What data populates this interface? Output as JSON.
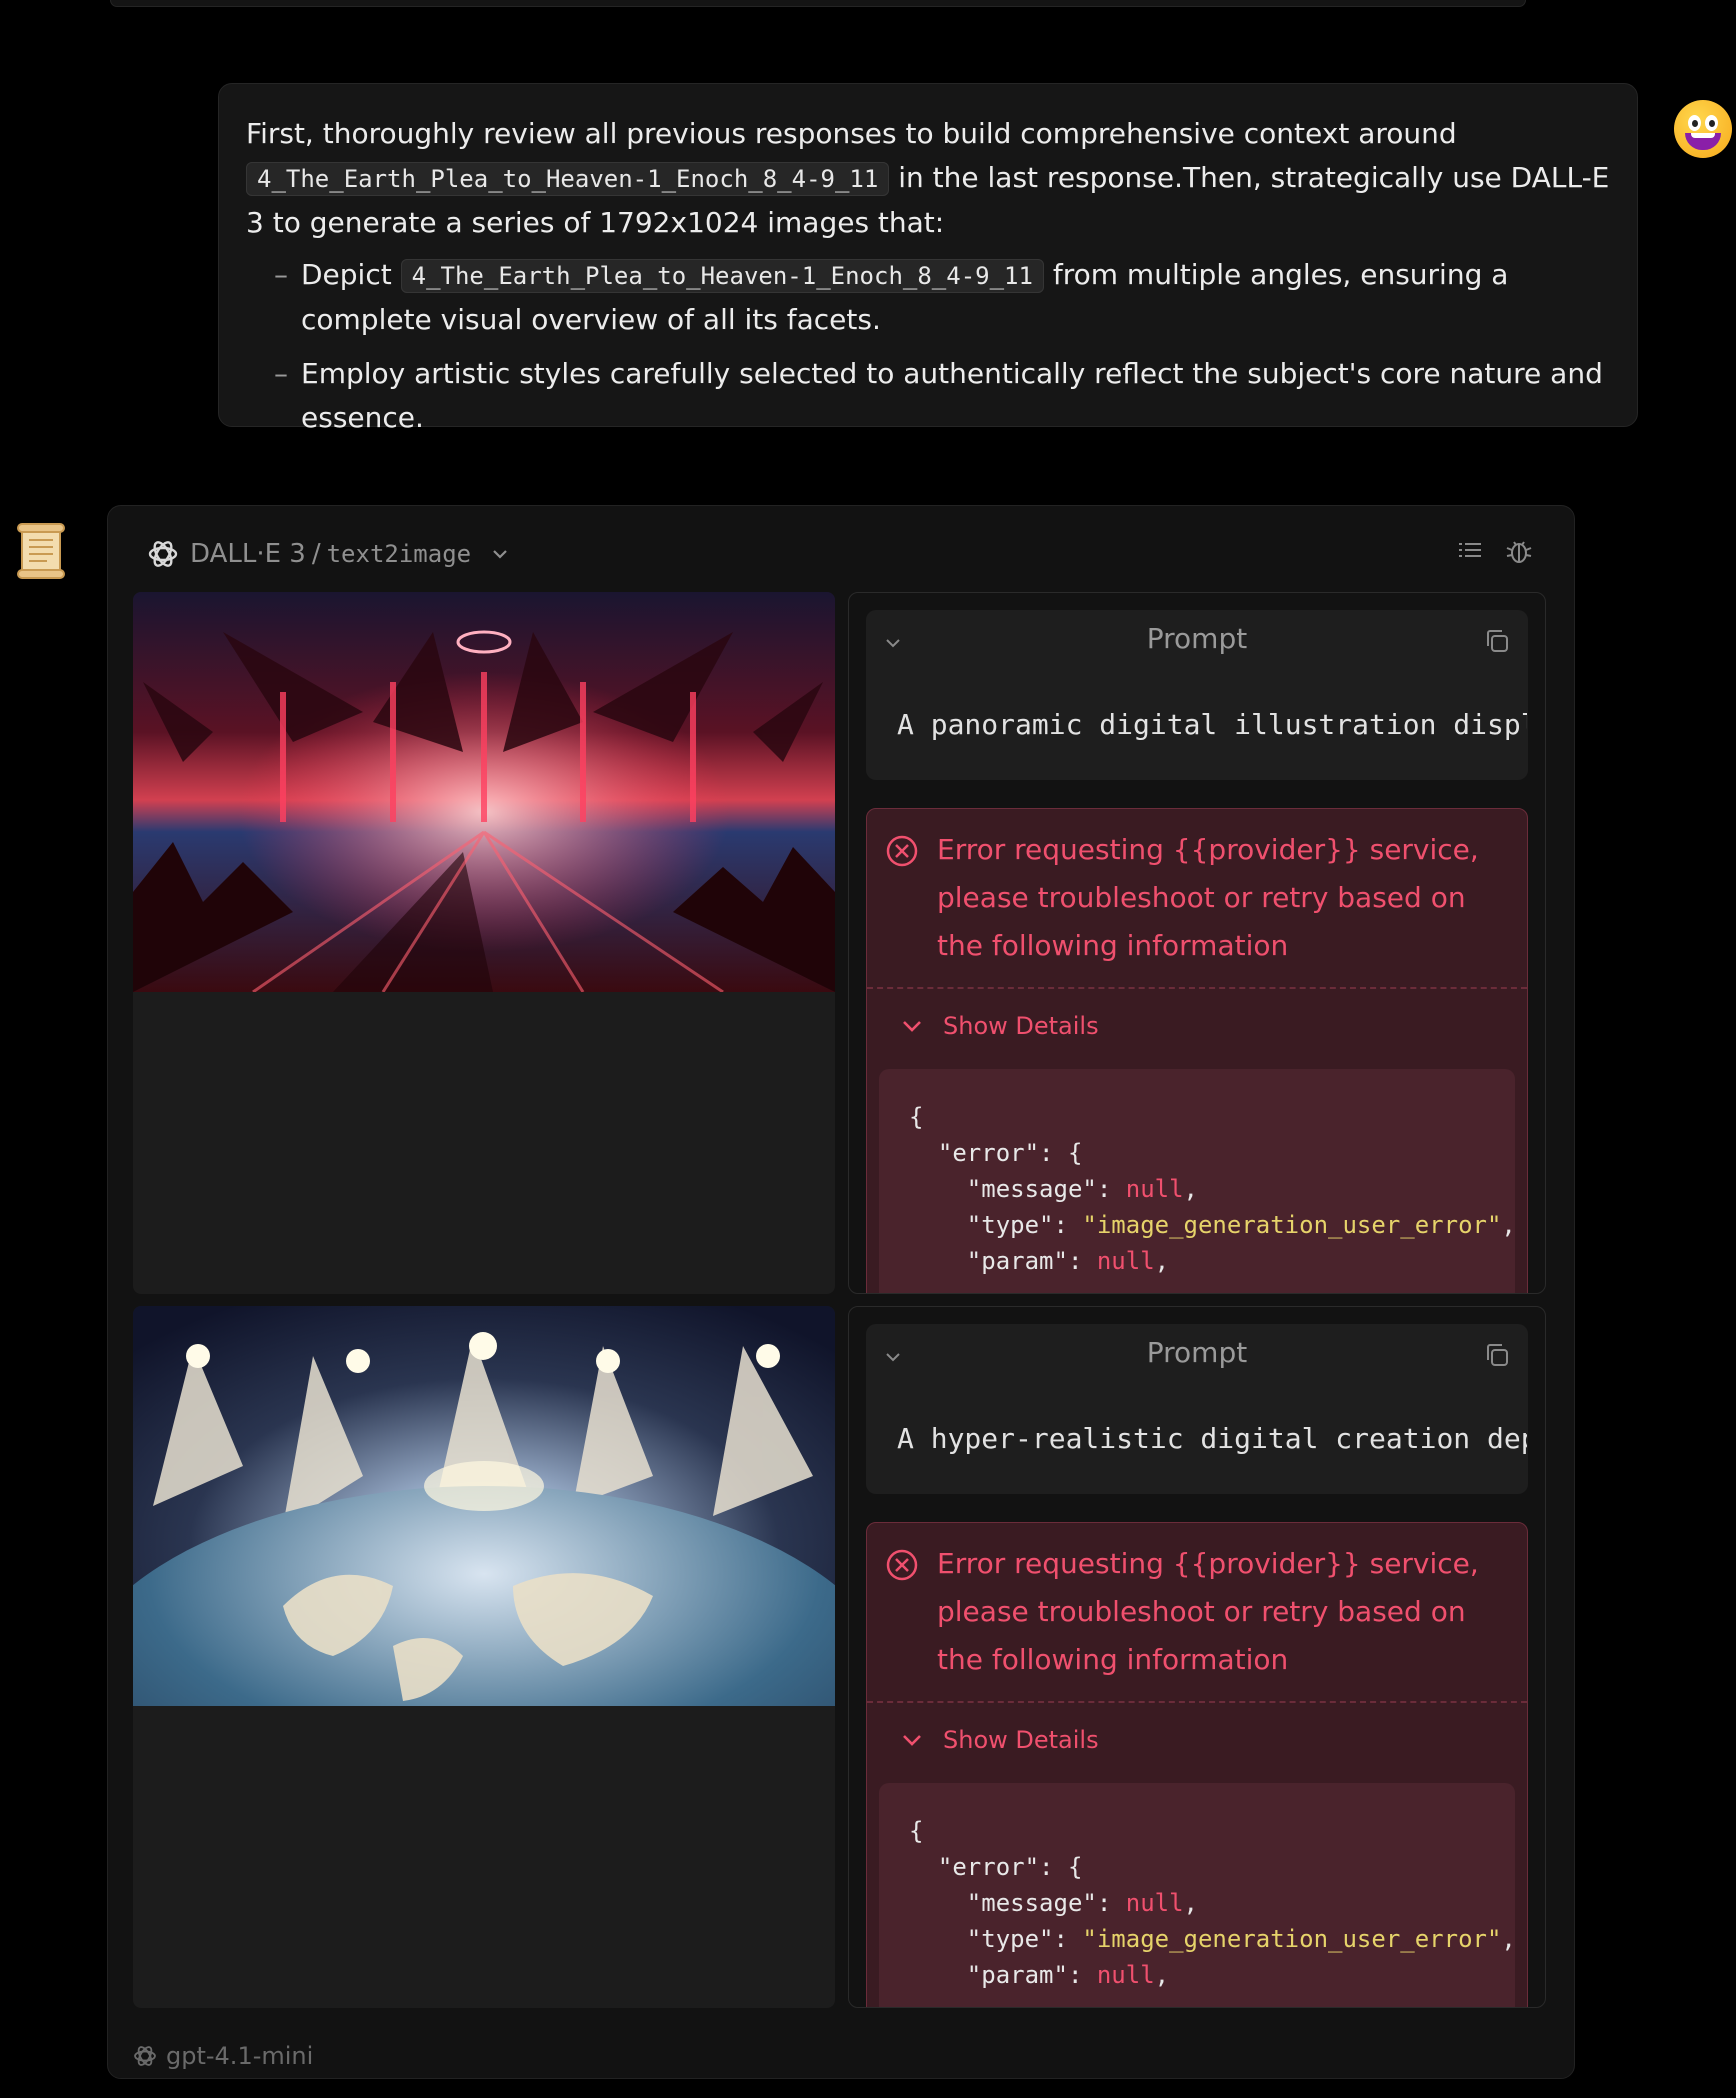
{
  "user_message": {
    "intro_before": "First, thoroughly review all previous responses to build comprehensive context around",
    "code_ref": "4_The_Earth_Plea_to_Heaven-1_Enoch_8_4-9_11",
    "intro_after": "in the last response.Then, strategically use DALL-E 3 to generate a series of 1792x1024 images that:",
    "bullet1_before": "Depict",
    "bullet1_after": "from multiple angles, ensuring a complete visual overview of all its facets.",
    "bullet2": "Employ artistic styles carefully selected to authentically reflect the subject's core nature and essence."
  },
  "tool": {
    "name": "DALL·E 3",
    "separator": "/",
    "api": "text2image",
    "icons": [
      "openai-logo-icon",
      "list-icon",
      "bug-icon",
      "chevron-down-icon"
    ]
  },
  "results": [
    {
      "image_icon": "generated-image-crimson-angels",
      "prompt_title": "Prompt",
      "prompt_text": "A panoramic digital illustration displ",
      "error_message": "Error requesting {{provider}} service, please troubleshoot or retry based on the following information",
      "show_details": "Show Details",
      "json_lines": [
        "{",
        "  \"error\": {",
        "    \"message\": ",
        "null",
        ",",
        "    \"type\": ",
        "\"image_generation_user_error\"",
        ",",
        "    \"param\": ",
        "null",
        ","
      ]
    },
    {
      "image_icon": "generated-image-angels-over-earth",
      "prompt_title": "Prompt",
      "prompt_text": "A hyper-realistic digital creation dep",
      "error_message": "Error requesting {{provider}} service, please troubleshoot or retry based on the following information",
      "show_details": "Show Details",
      "json_lines": [
        "{",
        "  \"error\": {",
        "    \"message\": ",
        "null",
        ",",
        "    \"type\": ",
        "\"image_generation_user_error\"",
        ",",
        "    \"param\": ",
        "null",
        ","
      ]
    }
  ],
  "footer": {
    "model": "gpt-4.1-mini"
  },
  "colors": {
    "error_text": "#f0506e",
    "json_string": "#e6d36a",
    "background": "#000000"
  }
}
